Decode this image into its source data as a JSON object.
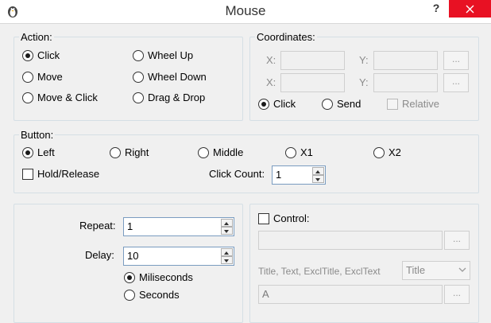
{
  "window": {
    "title": "Mouse",
    "help_label": "?"
  },
  "action": {
    "legend": "Action:",
    "options": [
      "Click",
      "Move",
      "Move & Click",
      "Wheel Up",
      "Wheel Down",
      "Drag & Drop"
    ],
    "selected": "Click"
  },
  "coordinates": {
    "legend": "Coordinates:",
    "x_label": "X:",
    "y_label": "Y:",
    "browse_label": "...",
    "mode_click": "Click",
    "mode_send": "Send",
    "relative_label": "Relative",
    "selected_mode": "Click"
  },
  "button": {
    "legend": "Button:",
    "options": [
      "Left",
      "Right",
      "Middle",
      "X1",
      "X2"
    ],
    "selected": "Left",
    "hold_release_label": "Hold/Release",
    "click_count_label": "Click Count:",
    "click_count_value": "1"
  },
  "timing": {
    "repeat_label": "Repeat:",
    "repeat_value": "1",
    "delay_label": "Delay:",
    "delay_value": "10",
    "unit_ms": "Miliseconds",
    "unit_s": "Seconds",
    "selected_unit": "Miliseconds"
  },
  "control": {
    "label": "Control:",
    "browse_label": "...",
    "match_label": "Title, Text, ExclTitle, ExclText",
    "match_mode": "Title",
    "text_value": "A"
  },
  "colors": {
    "close_red": "#e81123",
    "group_border": "#d5dfe5",
    "window_bg": "#f0f0f0"
  }
}
